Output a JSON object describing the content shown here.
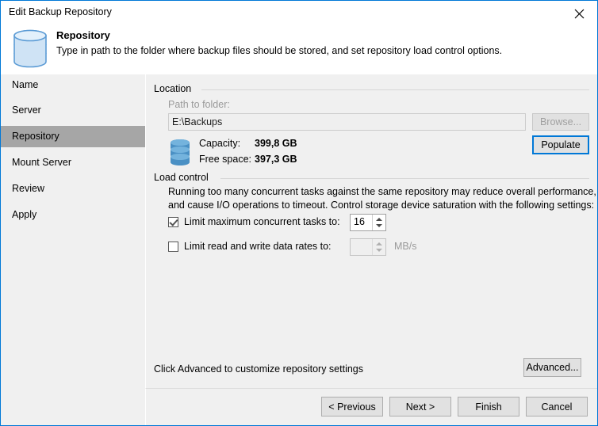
{
  "window": {
    "title": "Edit Backup Repository",
    "close_icon": "close-icon",
    "accent_color": "#0078d7",
    "selection_color": "#a6a6a6"
  },
  "header": {
    "icon": "repository-database-icon",
    "title": "Repository",
    "description": "Type in path to the folder where backup files should be stored, and set repository load control options."
  },
  "sidebar": {
    "items": [
      {
        "label": "Name",
        "selected": false
      },
      {
        "label": "Server",
        "selected": false
      },
      {
        "label": "Repository",
        "selected": true
      },
      {
        "label": "Mount Server",
        "selected": false
      },
      {
        "label": "Review",
        "selected": false
      },
      {
        "label": "Apply",
        "selected": false
      }
    ]
  },
  "location": {
    "group_label": "Location",
    "path_label": "Path to folder:",
    "path_value": "E:\\Backups",
    "path_placeholder": "",
    "browse_label": "Browse...",
    "browse_enabled": false,
    "populate_label": "Populate",
    "populate_focused": true,
    "disk_icon": "database-icon",
    "capacity_label": "Capacity:",
    "capacity_value": "399,8 GB",
    "free_space_label": "Free space:",
    "free_space_value": "397,3 GB"
  },
  "load_control": {
    "group_label": "Load control",
    "description_line1": "Running too many concurrent tasks against the same repository may reduce overall performance,",
    "description_line2": "and cause I/O operations to timeout. Control storage device saturation with the following settings:",
    "limit_tasks": {
      "label": "Limit maximum concurrent tasks to:",
      "checked": true,
      "value": "16"
    },
    "limit_rates": {
      "label": "Limit read and write data rates to:",
      "checked": false,
      "value": "",
      "unit": "MB/s"
    }
  },
  "advanced": {
    "hint": "Click Advanced to customize repository settings",
    "button_label": "Advanced..."
  },
  "footer": {
    "previous_label": "< Previous",
    "next_label": "Next >",
    "finish_label": "Finish",
    "cancel_label": "Cancel"
  }
}
